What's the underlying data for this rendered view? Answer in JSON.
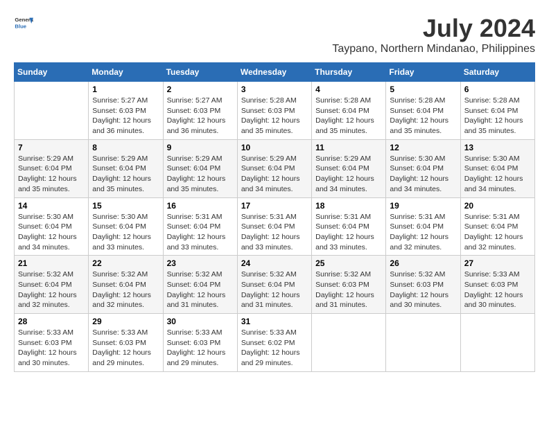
{
  "header": {
    "logo_general": "General",
    "logo_blue": "Blue",
    "title": "July 2024",
    "subtitle": "Taypano, Northern Mindanao, Philippines"
  },
  "days_of_week": [
    "Sunday",
    "Monday",
    "Tuesday",
    "Wednesday",
    "Thursday",
    "Friday",
    "Saturday"
  ],
  "weeks": [
    [
      {
        "day": "",
        "sunrise": "",
        "sunset": "",
        "daylight": ""
      },
      {
        "day": "1",
        "sunrise": "Sunrise: 5:27 AM",
        "sunset": "Sunset: 6:03 PM",
        "daylight": "Daylight: 12 hours and 36 minutes."
      },
      {
        "day": "2",
        "sunrise": "Sunrise: 5:27 AM",
        "sunset": "Sunset: 6:03 PM",
        "daylight": "Daylight: 12 hours and 36 minutes."
      },
      {
        "day": "3",
        "sunrise": "Sunrise: 5:28 AM",
        "sunset": "Sunset: 6:03 PM",
        "daylight": "Daylight: 12 hours and 35 minutes."
      },
      {
        "day": "4",
        "sunrise": "Sunrise: 5:28 AM",
        "sunset": "Sunset: 6:04 PM",
        "daylight": "Daylight: 12 hours and 35 minutes."
      },
      {
        "day": "5",
        "sunrise": "Sunrise: 5:28 AM",
        "sunset": "Sunset: 6:04 PM",
        "daylight": "Daylight: 12 hours and 35 minutes."
      },
      {
        "day": "6",
        "sunrise": "Sunrise: 5:28 AM",
        "sunset": "Sunset: 6:04 PM",
        "daylight": "Daylight: 12 hours and 35 minutes."
      }
    ],
    [
      {
        "day": "7",
        "sunrise": "Sunrise: 5:29 AM",
        "sunset": "Sunset: 6:04 PM",
        "daylight": "Daylight: 12 hours and 35 minutes."
      },
      {
        "day": "8",
        "sunrise": "Sunrise: 5:29 AM",
        "sunset": "Sunset: 6:04 PM",
        "daylight": "Daylight: 12 hours and 35 minutes."
      },
      {
        "day": "9",
        "sunrise": "Sunrise: 5:29 AM",
        "sunset": "Sunset: 6:04 PM",
        "daylight": "Daylight: 12 hours and 35 minutes."
      },
      {
        "day": "10",
        "sunrise": "Sunrise: 5:29 AM",
        "sunset": "Sunset: 6:04 PM",
        "daylight": "Daylight: 12 hours and 34 minutes."
      },
      {
        "day": "11",
        "sunrise": "Sunrise: 5:29 AM",
        "sunset": "Sunset: 6:04 PM",
        "daylight": "Daylight: 12 hours and 34 minutes."
      },
      {
        "day": "12",
        "sunrise": "Sunrise: 5:30 AM",
        "sunset": "Sunset: 6:04 PM",
        "daylight": "Daylight: 12 hours and 34 minutes."
      },
      {
        "day": "13",
        "sunrise": "Sunrise: 5:30 AM",
        "sunset": "Sunset: 6:04 PM",
        "daylight": "Daylight: 12 hours and 34 minutes."
      }
    ],
    [
      {
        "day": "14",
        "sunrise": "Sunrise: 5:30 AM",
        "sunset": "Sunset: 6:04 PM",
        "daylight": "Daylight: 12 hours and 34 minutes."
      },
      {
        "day": "15",
        "sunrise": "Sunrise: 5:30 AM",
        "sunset": "Sunset: 6:04 PM",
        "daylight": "Daylight: 12 hours and 33 minutes."
      },
      {
        "day": "16",
        "sunrise": "Sunrise: 5:31 AM",
        "sunset": "Sunset: 6:04 PM",
        "daylight": "Daylight: 12 hours and 33 minutes."
      },
      {
        "day": "17",
        "sunrise": "Sunrise: 5:31 AM",
        "sunset": "Sunset: 6:04 PM",
        "daylight": "Daylight: 12 hours and 33 minutes."
      },
      {
        "day": "18",
        "sunrise": "Sunrise: 5:31 AM",
        "sunset": "Sunset: 6:04 PM",
        "daylight": "Daylight: 12 hours and 33 minutes."
      },
      {
        "day": "19",
        "sunrise": "Sunrise: 5:31 AM",
        "sunset": "Sunset: 6:04 PM",
        "daylight": "Daylight: 12 hours and 32 minutes."
      },
      {
        "day": "20",
        "sunrise": "Sunrise: 5:31 AM",
        "sunset": "Sunset: 6:04 PM",
        "daylight": "Daylight: 12 hours and 32 minutes."
      }
    ],
    [
      {
        "day": "21",
        "sunrise": "Sunrise: 5:32 AM",
        "sunset": "Sunset: 6:04 PM",
        "daylight": "Daylight: 12 hours and 32 minutes."
      },
      {
        "day": "22",
        "sunrise": "Sunrise: 5:32 AM",
        "sunset": "Sunset: 6:04 PM",
        "daylight": "Daylight: 12 hours and 32 minutes."
      },
      {
        "day": "23",
        "sunrise": "Sunrise: 5:32 AM",
        "sunset": "Sunset: 6:04 PM",
        "daylight": "Daylight: 12 hours and 31 minutes."
      },
      {
        "day": "24",
        "sunrise": "Sunrise: 5:32 AM",
        "sunset": "Sunset: 6:04 PM",
        "daylight": "Daylight: 12 hours and 31 minutes."
      },
      {
        "day": "25",
        "sunrise": "Sunrise: 5:32 AM",
        "sunset": "Sunset: 6:03 PM",
        "daylight": "Daylight: 12 hours and 31 minutes."
      },
      {
        "day": "26",
        "sunrise": "Sunrise: 5:32 AM",
        "sunset": "Sunset: 6:03 PM",
        "daylight": "Daylight: 12 hours and 30 minutes."
      },
      {
        "day": "27",
        "sunrise": "Sunrise: 5:33 AM",
        "sunset": "Sunset: 6:03 PM",
        "daylight": "Daylight: 12 hours and 30 minutes."
      }
    ],
    [
      {
        "day": "28",
        "sunrise": "Sunrise: 5:33 AM",
        "sunset": "Sunset: 6:03 PM",
        "daylight": "Daylight: 12 hours and 30 minutes."
      },
      {
        "day": "29",
        "sunrise": "Sunrise: 5:33 AM",
        "sunset": "Sunset: 6:03 PM",
        "daylight": "Daylight: 12 hours and 29 minutes."
      },
      {
        "day": "30",
        "sunrise": "Sunrise: 5:33 AM",
        "sunset": "Sunset: 6:03 PM",
        "daylight": "Daylight: 12 hours and 29 minutes."
      },
      {
        "day": "31",
        "sunrise": "Sunrise: 5:33 AM",
        "sunset": "Sunset: 6:02 PM",
        "daylight": "Daylight: 12 hours and 29 minutes."
      },
      {
        "day": "",
        "sunrise": "",
        "sunset": "",
        "daylight": ""
      },
      {
        "day": "",
        "sunrise": "",
        "sunset": "",
        "daylight": ""
      },
      {
        "day": "",
        "sunrise": "",
        "sunset": "",
        "daylight": ""
      }
    ]
  ]
}
